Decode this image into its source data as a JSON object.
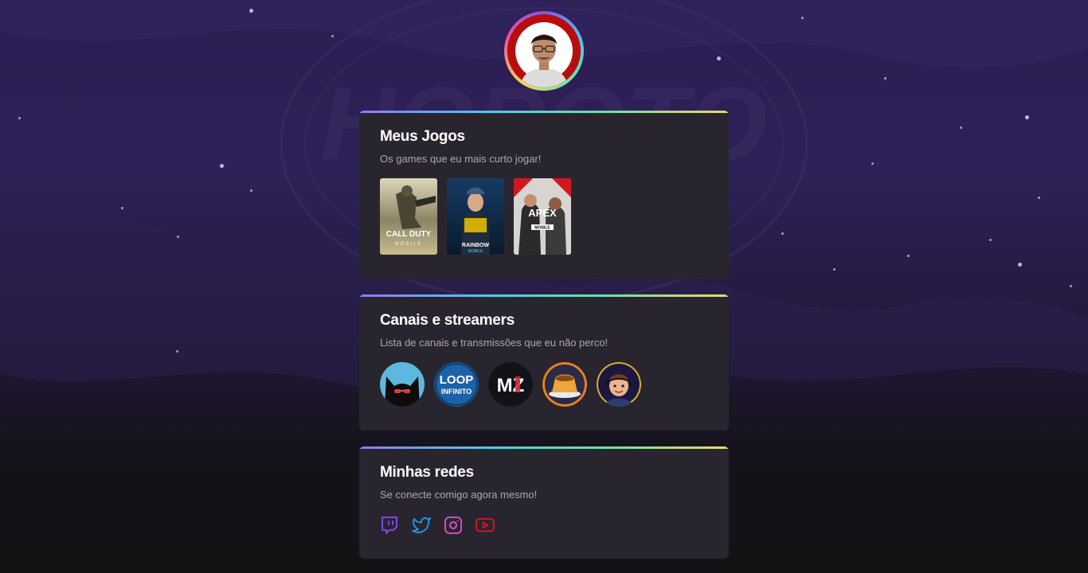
{
  "profile": {
    "avatar_alt": "profile-photo"
  },
  "games_card": {
    "title": "Meus Jogos",
    "subtitle": "Os games que eu mais curto jogar!",
    "games": [
      {
        "name": "call-of-duty-mobile",
        "label_line1": "CALL DUTY",
        "label_line2": "MOBILE"
      },
      {
        "name": "rainbow-six-mobile",
        "label_line1": "RAINBOW",
        "label_line2": "MOBILE"
      },
      {
        "name": "apex-legends-mobile",
        "label_line1": "APEX",
        "label_line2": "MOBILE"
      }
    ]
  },
  "channels_card": {
    "title": "Canais e streamers",
    "subtitle": "Lista de canais e transmissões que eu não perco!",
    "channels": [
      {
        "name": "channel-black-cat"
      },
      {
        "name": "channel-loop-infinito",
        "text_line1": "LOOP",
        "text_line2": "INFINITO"
      },
      {
        "name": "channel-mz",
        "text": "MZ"
      },
      {
        "name": "channel-pudim"
      },
      {
        "name": "channel-cartoon-guy"
      }
    ]
  },
  "social_card": {
    "title": "Minhas redes",
    "subtitle": "Se conecte comigo agora mesmo!",
    "links": [
      {
        "name": "twitch-icon",
        "color": "#9147ff"
      },
      {
        "name": "twitter-icon",
        "color": "#1d9bf0"
      },
      {
        "name": "instagram-icon",
        "color": "#e64ed1"
      },
      {
        "name": "youtube-icon",
        "color": "#e0141e"
      }
    ]
  }
}
